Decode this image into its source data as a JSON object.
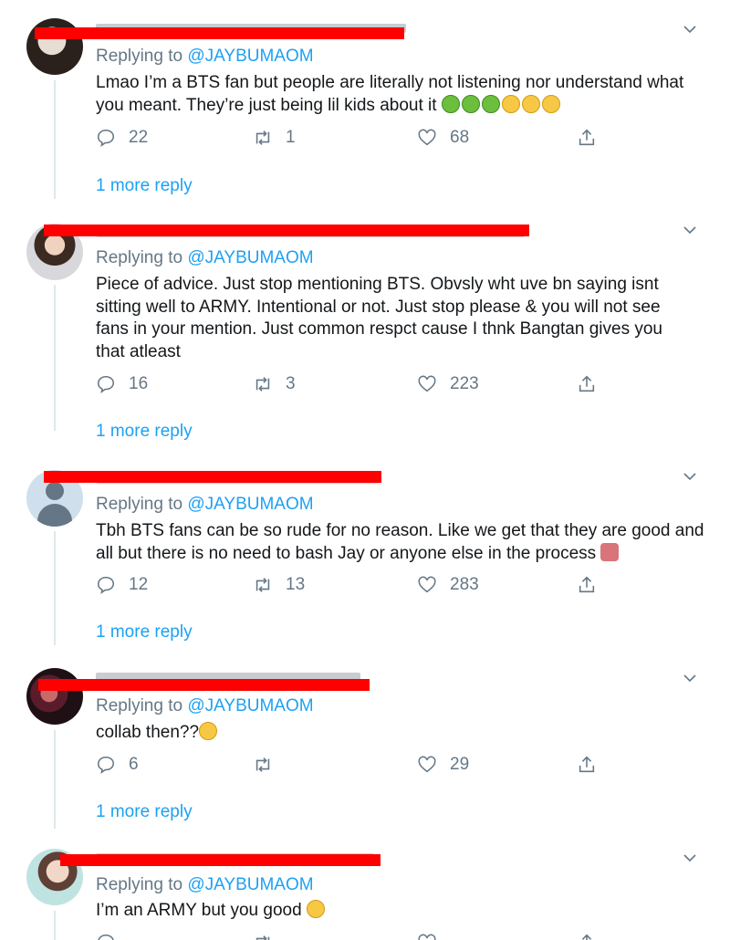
{
  "replying_prefix": "Replying to",
  "tweets": [
    {
      "reply_to": "@JAYBUMAOM",
      "text": "Lmao I’m a BTS fan but people are literally not listening nor understand what you meant. They’re just being lil kids about it",
      "emoji": [
        "nauseated-face",
        "nauseated-face",
        "nauseated-face",
        "vomiting-face",
        "vomiting-face",
        "vomiting-face"
      ],
      "replies": "22",
      "retweets": "1",
      "likes": "68",
      "more": "1 more reply"
    },
    {
      "reply_to": "@JAYBUMAOM",
      "text": "Piece of advice. Just stop mentioning BTS. Obvsly wht uve bn saying isnt sitting well to ARMY. Intentional or not. Just stop please & you will not see fans in your mention. Just common respct cause I thnk Bangtan gives  you that atleast",
      "replies": "16",
      "retweets": "3",
      "likes": "223",
      "more": "1 more reply"
    },
    {
      "reply_to": "@JAYBUMAOM",
      "text": "Tbh BTS fans can be so rude for no reason. Like we get that they are good and all but there is no need to bash Jay or anyone else in the process",
      "emoji": [
        "person-facepalming"
      ],
      "replies": "12",
      "retweets": "13",
      "likes": "283",
      "more": "1 more reply"
    },
    {
      "reply_to": "@JAYBUMAOM",
      "text": "collab then??",
      "emoji": [
        "grinning-squinting-face"
      ],
      "replies": "6",
      "retweets": "",
      "likes": "29",
      "more": "1 more reply"
    },
    {
      "reply_to": "@JAYBUMAOM",
      "text": "I’m an ARMY but you good",
      "emoji": [
        "kissing-face"
      ],
      "replies": "",
      "retweets": "",
      "likes": ""
    }
  ],
  "colors": {
    "link": "#1da1f2",
    "muted": "#657786",
    "redaction": "#ff0000"
  },
  "icons": [
    "reply-icon",
    "retweet-icon",
    "like-icon",
    "share-icon",
    "chevron-down-icon"
  ]
}
